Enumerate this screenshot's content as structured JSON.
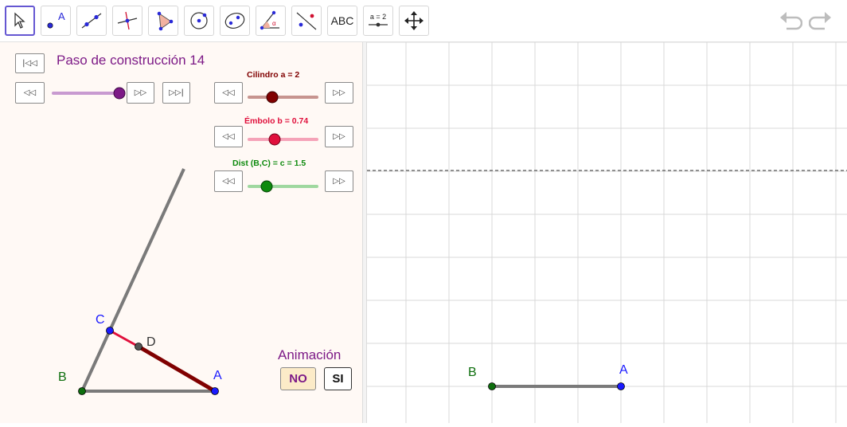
{
  "toolbar": {
    "tools": [
      {
        "name": "move-tool"
      },
      {
        "name": "point-tool",
        "label": "A"
      },
      {
        "name": "line-tool"
      },
      {
        "name": "perpendicular-line-tool"
      },
      {
        "name": "polygon-tool"
      },
      {
        "name": "circle-tool"
      },
      {
        "name": "ellipse-tool"
      },
      {
        "name": "angle-tool",
        "label": "α"
      },
      {
        "name": "reflect-tool"
      },
      {
        "name": "text-tool",
        "label": "ABC"
      },
      {
        "name": "slider-tool",
        "label": "a = 2"
      },
      {
        "name": "move-graphics-view-tool"
      }
    ]
  },
  "algebra": {
    "step_title": "Paso de construcción 14",
    "sliders": [
      {
        "label": "Cilindro  a = 2",
        "color": "#800000",
        "value": 0.3
      },
      {
        "label": "Émbolo b = 0.74",
        "color": "#e0103c",
        "value": 0.37
      },
      {
        "label": "Dist (B,C) = c = 1.5",
        "color": "#0d8a0d",
        "value": 0.25
      }
    ],
    "step_slider": {
      "color": "#7d1a87",
      "value": 1.0
    },
    "points": {
      "A": "A",
      "B": "B",
      "C": "C",
      "D": "D"
    },
    "animation": {
      "title": "Animación",
      "no_label": "NO",
      "si_label": "SI"
    }
  },
  "graphics": {
    "points": {
      "A": "A",
      "B": "B"
    }
  },
  "colors": {
    "purple": "#7d1a87",
    "blue_point": "#1a1aff",
    "green_point": "#0d6e0d"
  }
}
